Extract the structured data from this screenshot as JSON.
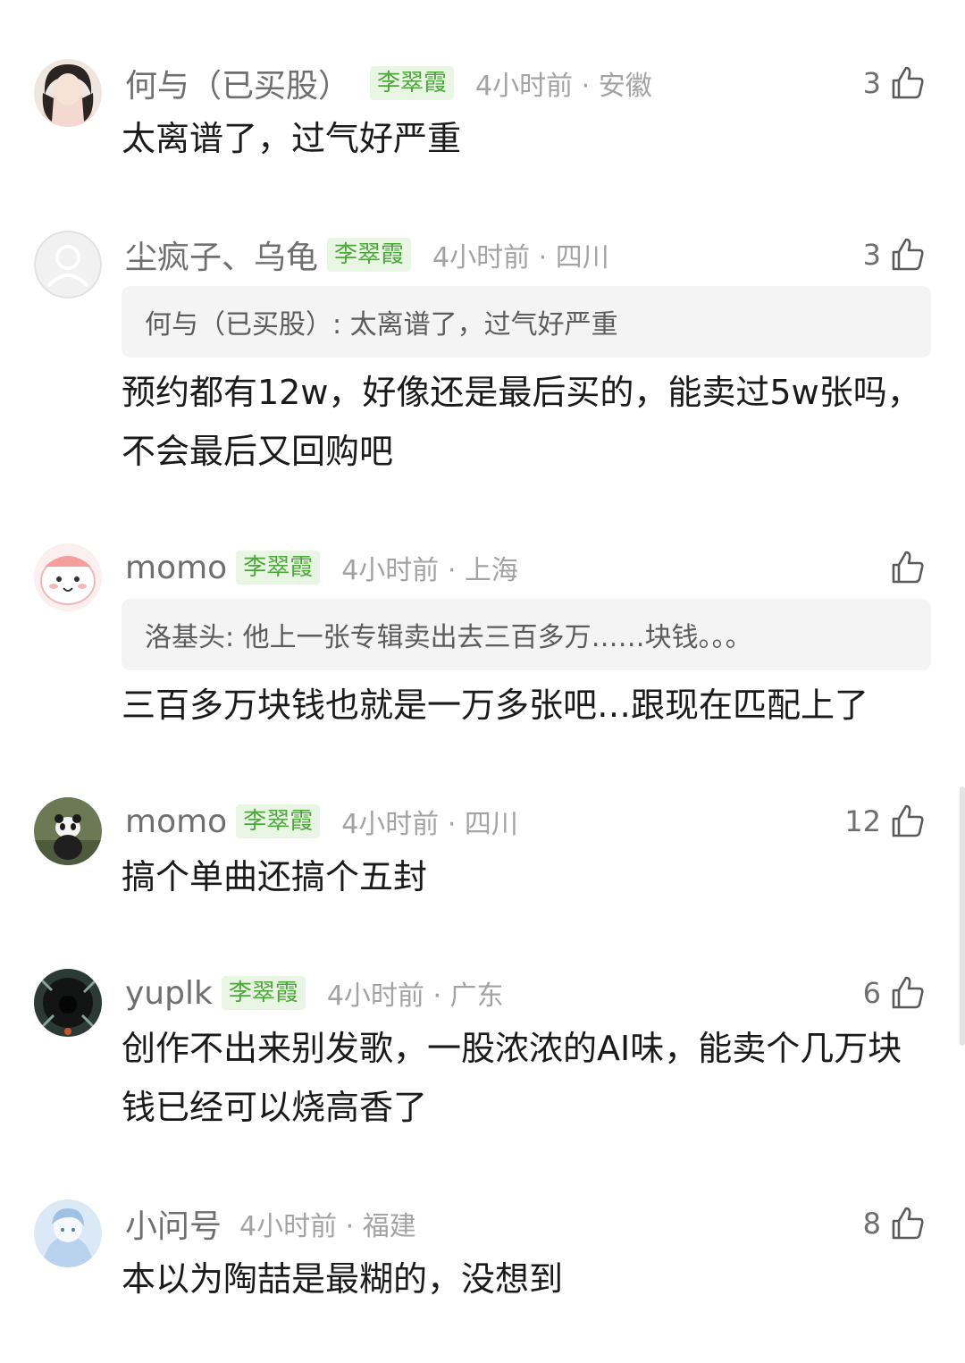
{
  "comments": [
    {
      "username": "何与（已买股）",
      "badge": "李翠霞",
      "meta": "4小时前 · 安徽",
      "likes": "3",
      "quote": "",
      "text": "太离谱了，过气好严重",
      "avatar_icon": "girl-photo-avatar"
    },
    {
      "username": "尘疯子、乌龟",
      "badge": "李翠霞",
      "meta": "4小时前 · 四川",
      "likes": "3",
      "quote": "何与（已买股）: 太离谱了，过气好严重",
      "text": "预约都有12w，好像还是最后买的，能卖过5w张吗，不会最后又回购吧",
      "avatar_icon": "default-user-avatar"
    },
    {
      "username": "momo",
      "badge": "李翠霞",
      "meta": "4小时前 · 上海",
      "likes": "",
      "quote": "洛基头: 他上一张专辑卖出去三百多万……块钱。。。",
      "text": "三百多万块钱也就是一万多张吧…跟现在匹配上了",
      "avatar_icon": "pink-cartoon-avatar"
    },
    {
      "username": "momo",
      "badge": "李翠霞",
      "meta": "4小时前 · 四川",
      "likes": "12",
      "quote": "",
      "text": "搞个单曲还搞个五封",
      "avatar_icon": "panda-photo-avatar"
    },
    {
      "username": "yuplk",
      "badge": "李翠霞",
      "meta": "4小时前 · 广东",
      "likes": "6",
      "quote": "",
      "text": "创作不出来别发歌，一股浓浓的AI味，能卖个几万块钱已经可以烧高香了",
      "avatar_icon": "dark-photo-avatar"
    },
    {
      "username": "小问号",
      "badge": "",
      "meta": "4小时前 · 福建",
      "likes": "8",
      "quote": "",
      "text": "本以为陶喆是最糊的，没想到",
      "avatar_icon": "blue-anime-avatar"
    }
  ],
  "icons": {
    "like": "thumbs-up-icon"
  },
  "colors": {
    "badge_bg": "#eaf6e4",
    "badge_text": "#4ca63a",
    "username": "#6f6f6f",
    "meta": "#a3a3a3",
    "quote_bg": "#f4f4f4"
  }
}
